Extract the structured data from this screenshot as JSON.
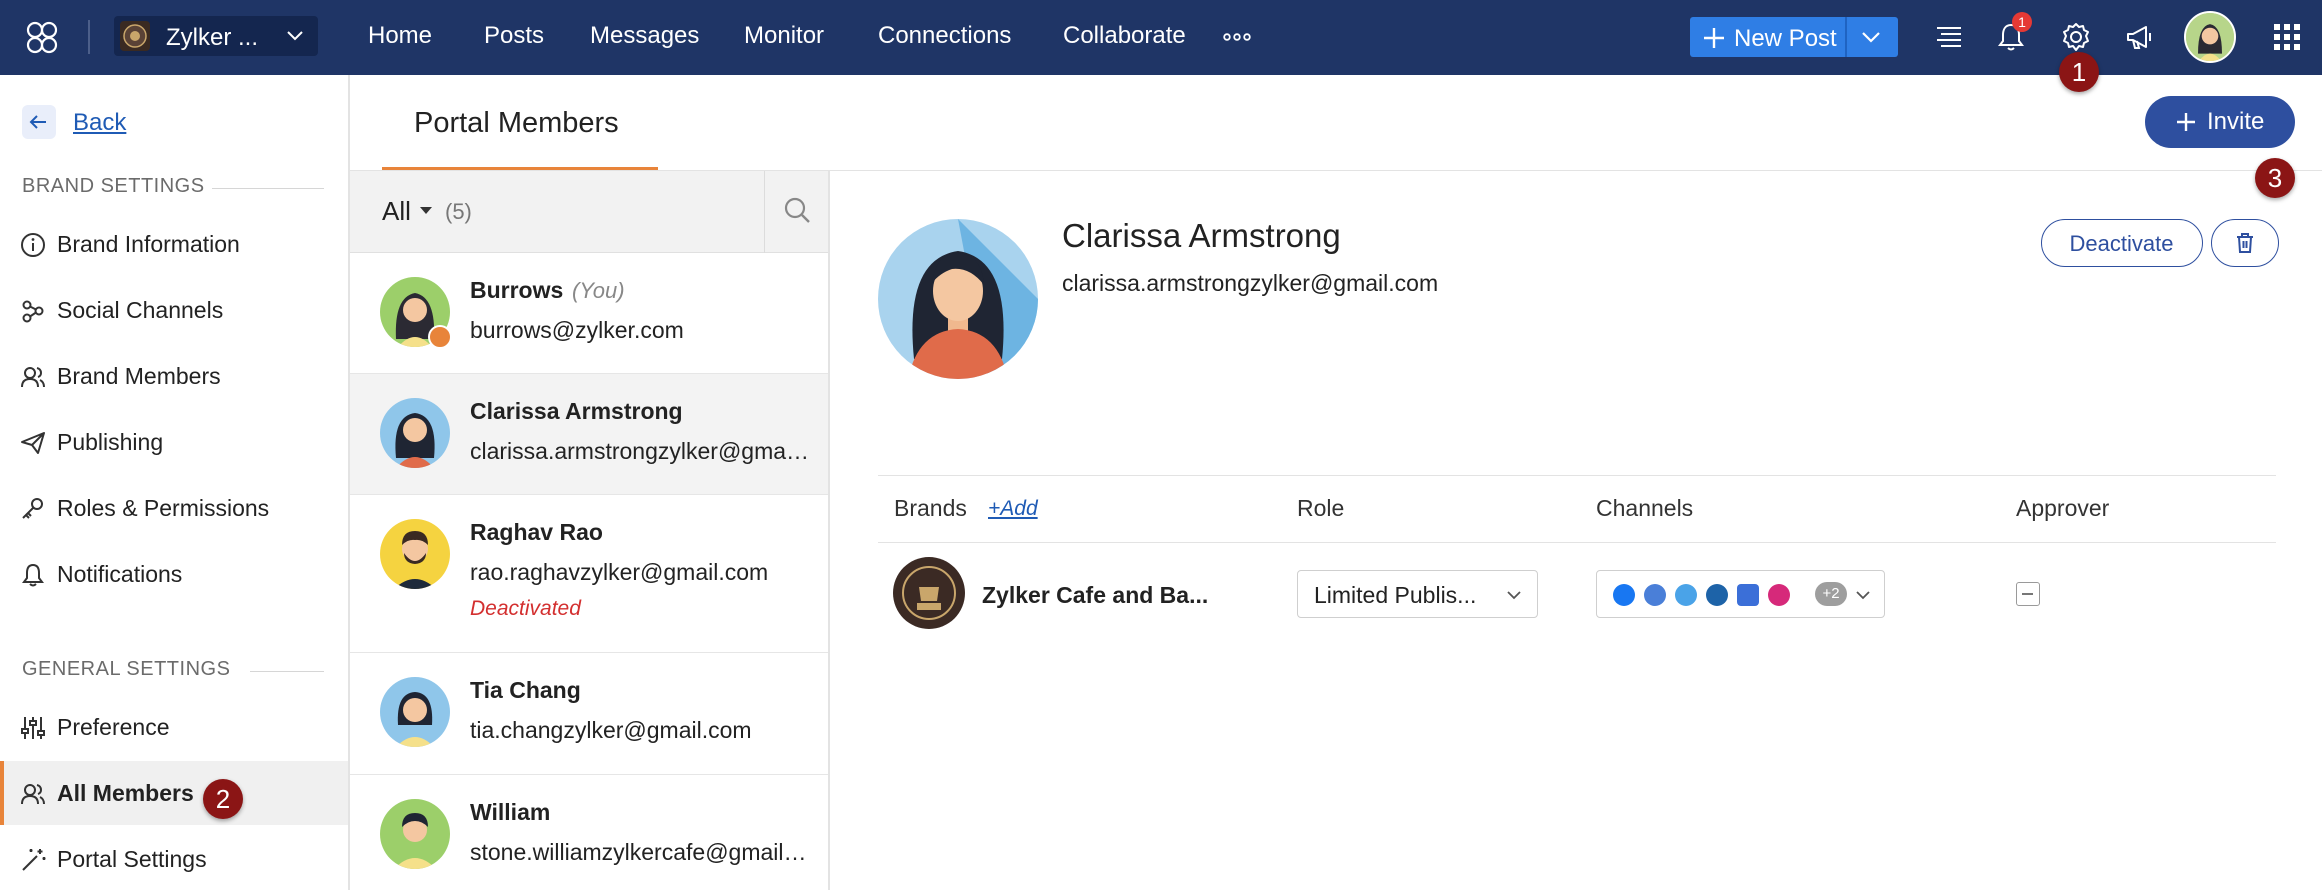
{
  "topbar": {
    "brand_name": "Zylker ...",
    "nav": [
      "Home",
      "Posts",
      "Messages",
      "Monitor",
      "Connections",
      "Collaborate"
    ],
    "new_post_label": "New Post",
    "notification_count": "1"
  },
  "steps": [
    "1",
    "2",
    "3"
  ],
  "sidebar": {
    "back_label": "Back",
    "brand_settings_title": "BRAND SETTINGS",
    "brand_items": [
      "Brand Information",
      "Social Channels",
      "Brand Members",
      "Publishing",
      "Roles & Permissions",
      "Notifications"
    ],
    "general_settings_title": "GENERAL SETTINGS",
    "general_items": [
      "Preference",
      "All Members",
      "Portal Settings"
    ],
    "active_item": "All Members"
  },
  "header": {
    "title": "Portal Members",
    "invite_label": "Invite"
  },
  "list": {
    "filter_label": "All",
    "filter_count": "(5)",
    "members": [
      {
        "name": "Burrows",
        "tag": "(You)",
        "email": "burrows@zylker.com",
        "status": ""
      },
      {
        "name": "Clarissa Armstrong",
        "tag": "",
        "email": "clarissa.armstrongzylker@gmail.com",
        "status": ""
      },
      {
        "name": "Raghav Rao",
        "tag": "",
        "email": "rao.raghavzylker@gmail.com",
        "status": "Deactivated"
      },
      {
        "name": "Tia Chang",
        "tag": "",
        "email": "tia.changzylker@gmail.com",
        "status": ""
      },
      {
        "name": "William",
        "tag": "",
        "email": "stone.williamzylkercafe@gmail.com",
        "status": ""
      }
    ],
    "selected_index": 1
  },
  "detail": {
    "name": "Clarissa Armstrong",
    "email": "clarissa.armstrongzylker@gmail.com",
    "deactivate_label": "Deactivate",
    "table": {
      "headers": {
        "brands": "Brands",
        "add": "+Add",
        "role": "Role",
        "channels": "Channels",
        "approver": "Approver"
      },
      "rows": [
        {
          "brand": "Zylker Cafe and Ba...",
          "role": "Limited Publis...",
          "channels": [
            "facebook",
            "facebook-groups",
            "twitter",
            "linkedin",
            "google-business",
            "instagram"
          ],
          "more_channels": "+2",
          "approver": false
        }
      ]
    }
  },
  "colors": {
    "topbar_bg": "#1f3566",
    "accent": "#2e4f9f",
    "new_post": "#2f7ee5",
    "active_marker": "#e8843a",
    "step_badge": "#8b1515",
    "deactivated_text": "#d32f2f"
  }
}
